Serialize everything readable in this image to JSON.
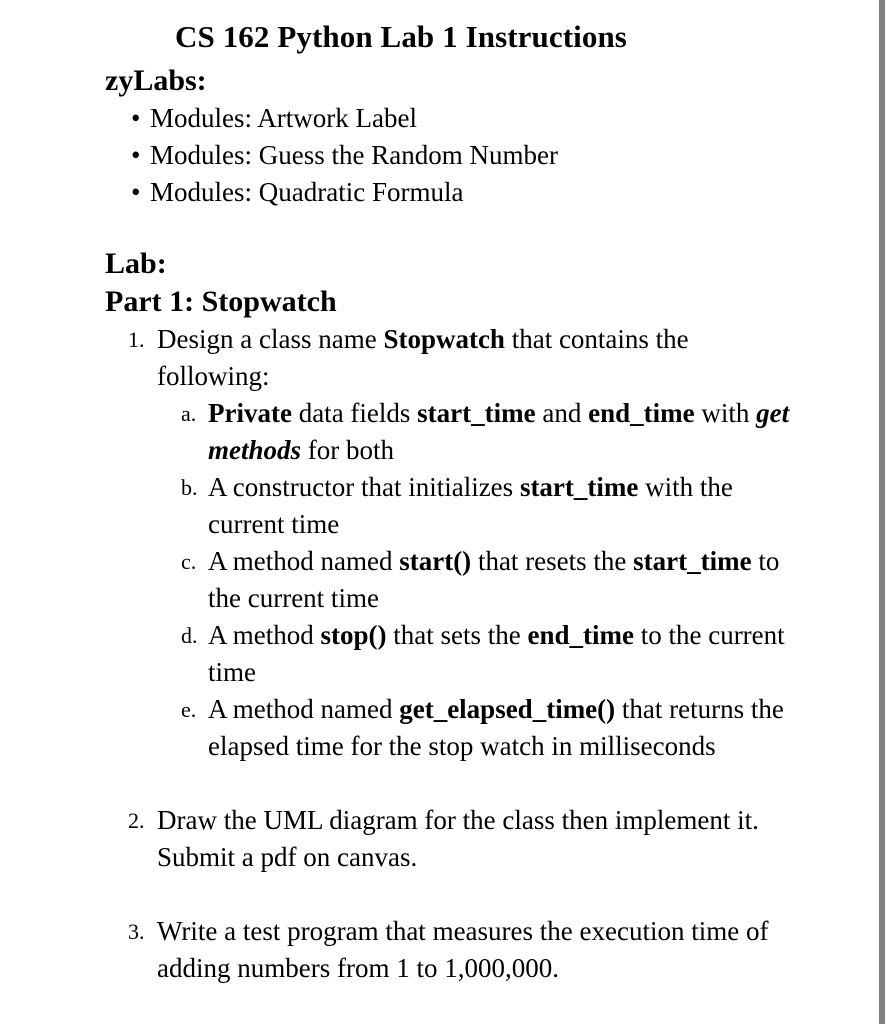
{
  "document": {
    "title": "CS 162 Python Lab 1 Instructions",
    "text_color": "#000000",
    "background_color": "#ffffff",
    "rule_color": "#808080"
  },
  "zylabs": {
    "heading": "zyLabs:",
    "bullet_mark": "•",
    "items": [
      "Modules: Artwork Label",
      "Modules: Guess the Random Number",
      "Modules: Quadratic Formula"
    ]
  },
  "lab": {
    "heading": "Lab:",
    "part_heading": "Part 1: Stopwatch",
    "items": [
      {
        "marker": "1.",
        "text_before": "Design a class name ",
        "bold": "Stopwatch",
        "text_after": " that contains the following:",
        "subitems": [
          {
            "marker": "a.",
            "segments": [
              {
                "text": "Private",
                "style": "bold"
              },
              {
                "text": " data fields ",
                "style": "normal"
              },
              {
                "text": "start_time",
                "style": "bold"
              },
              {
                "text": " and ",
                "style": "normal"
              },
              {
                "text": "end_time",
                "style": "bold"
              },
              {
                "text": " with ",
                "style": "normal"
              },
              {
                "text": "get methods",
                "style": "bold-italic"
              },
              {
                "text": " for both",
                "style": "normal"
              }
            ]
          },
          {
            "marker": "b.",
            "segments": [
              {
                "text": "A constructor that initializes ",
                "style": "normal"
              },
              {
                "text": "start_time",
                "style": "bold"
              },
              {
                "text": " with the current time",
                "style": "normal"
              }
            ]
          },
          {
            "marker": "c.",
            "segments": [
              {
                "text": "A method named ",
                "style": "normal"
              },
              {
                "text": "start()",
                "style": "bold"
              },
              {
                "text": " that resets the ",
                "style": "normal"
              },
              {
                "text": "start_time",
                "style": "bold"
              },
              {
                "text": " to the current time",
                "style": "normal"
              }
            ]
          },
          {
            "marker": "d.",
            "segments": [
              {
                "text": "A method ",
                "style": "normal"
              },
              {
                "text": "stop()",
                "style": "bold"
              },
              {
                "text": " that sets the ",
                "style": "normal"
              },
              {
                "text": "end_time",
                "style": "bold"
              },
              {
                "text": " to the current time",
                "style": "normal"
              }
            ]
          },
          {
            "marker": "e.",
            "segments": [
              {
                "text": "A method named ",
                "style": "normal"
              },
              {
                "text": "get_elapsed_time()",
                "style": "bold"
              },
              {
                "text": " that returns the elapsed time for the stop watch in milliseconds",
                "style": "normal"
              }
            ]
          }
        ]
      },
      {
        "marker": "2.",
        "plain": "Draw the UML diagram for the class then implement it. Submit a pdf on canvas."
      },
      {
        "marker": "3.",
        "plain": "Write a test program that measures the execution time of adding numbers from 1 to 1,000,000."
      }
    ]
  }
}
